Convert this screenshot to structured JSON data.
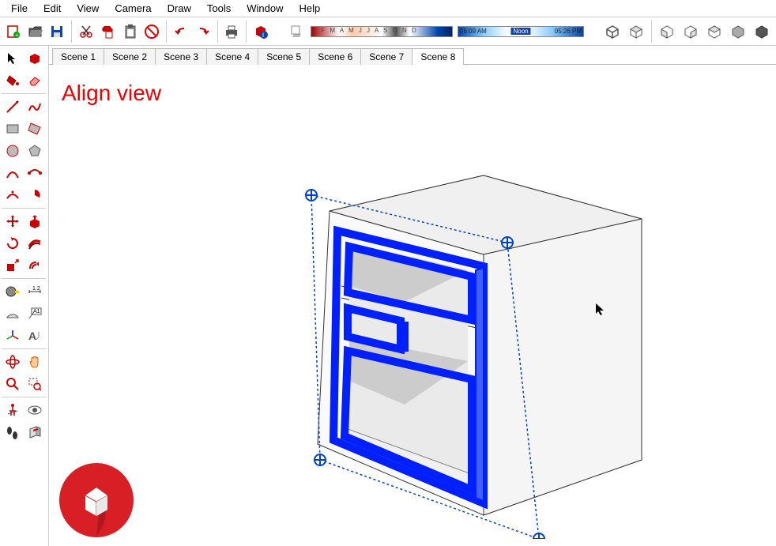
{
  "menu": {
    "items": [
      "File",
      "Edit",
      "View",
      "Camera",
      "Draw",
      "Tools",
      "Window",
      "Help"
    ]
  },
  "shadow": {
    "months": "J F M A M J J A S O N D",
    "time_start": "06:09 AM",
    "time_noon": "Noon",
    "time_end": "05:26 PM"
  },
  "scenes": {
    "tabs": [
      "Scene 1",
      "Scene 2",
      "Scene 3",
      "Scene 4",
      "Scene 5",
      "Scene 6",
      "Scene 7",
      "Scene 8"
    ],
    "active_index": 7
  },
  "viewport": {
    "annotation": "Align view"
  },
  "icons": {
    "accent": "#c00",
    "gray": "#555",
    "blue": "#14a"
  }
}
